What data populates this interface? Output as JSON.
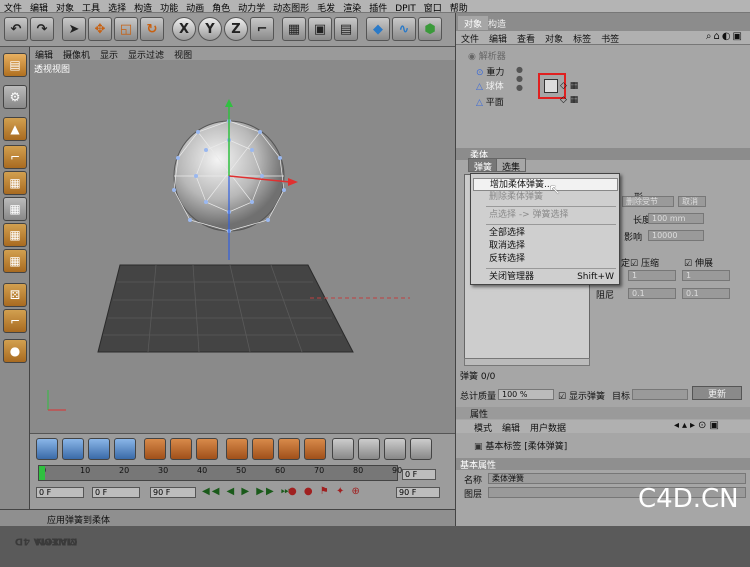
{
  "menubar": [
    "文件",
    "编辑",
    "对象",
    "工具",
    "选择",
    "构造",
    "功能",
    "动画",
    "角色",
    "动力学",
    "动态图形",
    "毛发",
    "渲染",
    "插件",
    "DPIT",
    "窗口",
    "帮助"
  ],
  "toolbar_icons": [
    "undo-icon",
    "redo-icon",
    "select-arrow-icon",
    "move-icon",
    "scale-icon",
    "rotate-icon",
    "x-axis-icon",
    "y-axis-icon",
    "z-axis-icon",
    "world-coords-icon",
    "render-view-icon",
    "render-picture-icon",
    "render-settings-icon",
    "cube-icon",
    "spline-icon",
    "nurbs-icon"
  ],
  "axis_labels": {
    "x": "X",
    "y": "Y",
    "z": "Z"
  },
  "viewport": {
    "menu": [
      "编辑",
      "摄像机",
      "显示",
      "显示过滤",
      "视图"
    ],
    "title": "透视视图"
  },
  "timeline": {
    "ticks": [
      "0",
      "10",
      "20",
      "30",
      "40",
      "50",
      "60",
      "70",
      "80",
      "90"
    ],
    "end_label": "0 F",
    "frame_start": "0 F",
    "frame_min": "0 F",
    "frame_max": "90 F",
    "frame_end": "90 F"
  },
  "status": {
    "text": "应用弹簧到柔体"
  },
  "object_manager": {
    "tabs": [
      "对象",
      "构造"
    ],
    "menu": [
      "文件",
      "编辑",
      "查看",
      "对象",
      "标签",
      "书签"
    ],
    "objects": [
      {
        "name": "解析器",
        "indent": 0
      },
      {
        "name": "重力",
        "indent": 1
      },
      {
        "name": "球体",
        "indent": 1
      },
      {
        "name": "平面",
        "indent": 1
      }
    ]
  },
  "tag_manager": {
    "section_title": "柔体",
    "tabs": [
      "弹簧",
      "选集"
    ],
    "partial_labels": {
      "shape": "形",
      "cancel_left": "删除受节",
      "cancel_right": "取消",
      "length": "长度",
      "length_value": "100 mm",
      "influence": "影响",
      "influence_value": "10000",
      "fixed": "定",
      "compress": "压缩",
      "stretch": "伸展",
      "damping": "阻尼",
      "v1": "1",
      "v2": "1",
      "d1": "0.1",
      "d2": "0.1"
    },
    "spring_count": "弹簧 0/0",
    "total_mass_label": "总计质量",
    "total_mass_value": "100 %",
    "show_spring_label": "显示弹簧",
    "target_label": "目标",
    "update_button": "更新"
  },
  "context_menu": {
    "items": [
      {
        "label": "增加柔体弹簧...",
        "highlight": true,
        "disabled": false
      },
      {
        "label": "删除柔体弹簧",
        "highlight": false,
        "disabled": true
      },
      {
        "label": "点选择 -> 弹簧选择",
        "highlight": false,
        "disabled": true
      },
      {
        "label": "全部选择",
        "highlight": false,
        "disabled": false
      },
      {
        "label": "取消选择",
        "highlight": false,
        "disabled": false
      },
      {
        "label": "反转选择",
        "highlight": false,
        "disabled": false
      },
      {
        "label": "关闭管理器",
        "highlight": false,
        "disabled": false
      }
    ],
    "shortcut": "Shift+W"
  },
  "attributes": {
    "title": "属性",
    "menu": [
      "模式",
      "编辑",
      "用户数据"
    ],
    "tag_title": "基本标签 [柔体弹簧]",
    "section": "基本属性",
    "name_label": "名称",
    "name_value": "柔体弹簧",
    "layer_label": "图层"
  },
  "brand": {
    "line1": "MAXON",
    "line2": "CINEMA 4D"
  },
  "watermark": "C4D.CN",
  "colors": {
    "highlight_red": "#e02020",
    "axis_green": "#30c040",
    "axis_red": "#e03030",
    "axis_blue": "#3060e0"
  }
}
